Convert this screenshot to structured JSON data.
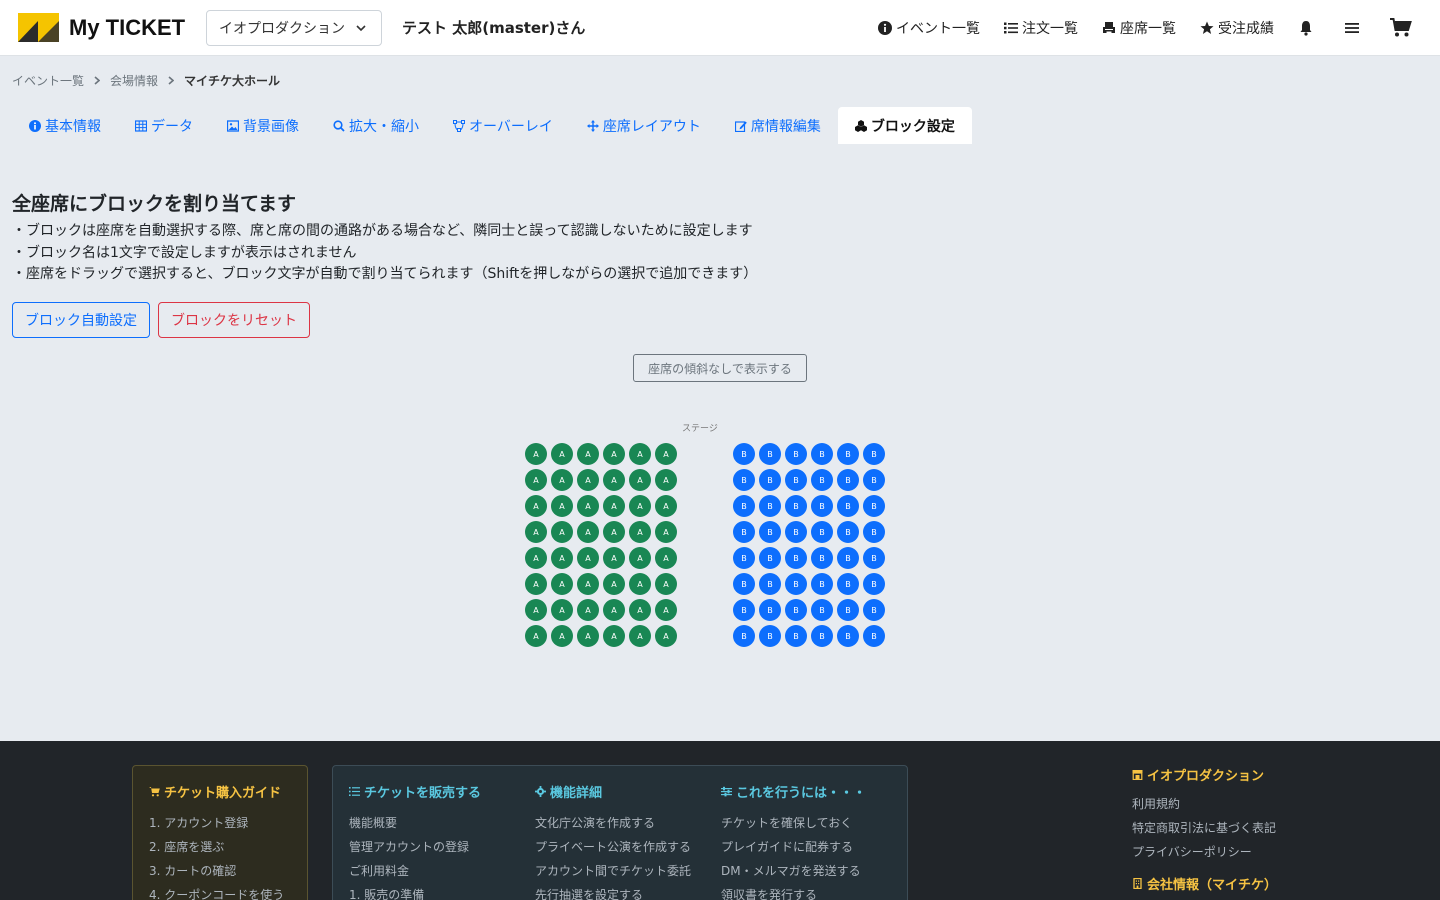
{
  "header": {
    "logo_text": "My TICKET",
    "org_selected": "イオプロダクション",
    "user_name": "テスト 太郎(master)さん",
    "nav": {
      "events": "イベント一覧",
      "orders": "注文一覧",
      "seats": "座席一覧",
      "results": "受注成績"
    }
  },
  "breadcrumb": {
    "items": [
      "イベント一覧",
      "会場情報",
      "マイチケ大ホール"
    ]
  },
  "tabs": [
    {
      "label": "基本情報"
    },
    {
      "label": "データ"
    },
    {
      "label": "背景画像"
    },
    {
      "label": "拡大・縮小"
    },
    {
      "label": "オーバーレイ"
    },
    {
      "label": "座席レイアウト"
    },
    {
      "label": "席情報編集"
    },
    {
      "label": "ブロック設定"
    }
  ],
  "content": {
    "title": "全座席にブロックを割り当てます",
    "lines": [
      "・ブロックは座席を自動選択する際、席と席の間の通路がある場合など、隣同士と誤って認識しないために設定します",
      "・ブロック名は1文字で設定しますが表示はされません",
      "・座席をドラッグで選択すると、ブロック文字が自動で割り当てられます（Shiftを押しながらの選択で追加できます）"
    ],
    "btn_auto": "ブロック自動設定",
    "btn_reset": "ブロックをリセット",
    "btn_tilt": "座席の傾斜なしで表示する",
    "stage_label": "ステージ"
  },
  "seat_map": {
    "rows": 8,
    "cols_per_block": 6,
    "blocks": [
      {
        "letter": "A",
        "color": "#198754"
      },
      {
        "letter": "B",
        "color": "#0d6efd"
      }
    ]
  },
  "footer": {
    "guide": {
      "title": "チケット購入ガイド",
      "items": [
        "1. アカウント登録",
        "2. 座席を選ぶ",
        "3. カートの確認",
        "4. クーポンコードを使う"
      ]
    },
    "sell": {
      "title": "チケットを販売する",
      "items": [
        "機能概要",
        "管理アカウントの登録",
        "ご利用料金",
        "1. 販売の準備"
      ]
    },
    "features": {
      "title": "機能詳細",
      "items": [
        "文化庁公演を作成する",
        "プライベート公演を作成する",
        "アカウント間でチケット委託",
        "先行抽選を設定する"
      ]
    },
    "howto": {
      "title": "これを行うには・・・",
      "items": [
        "チケットを確保しておく",
        "プレイガイドに配券する",
        "DM・メルマガを発送する",
        "領収書を発行する"
      ]
    },
    "company": {
      "title": "イオプロダクション",
      "items": [
        "利用規約",
        "特定商取引法に基づく表記",
        "プライバシーポリシー"
      ]
    },
    "company2": {
      "title": "会社情報（マイチケ）"
    }
  }
}
